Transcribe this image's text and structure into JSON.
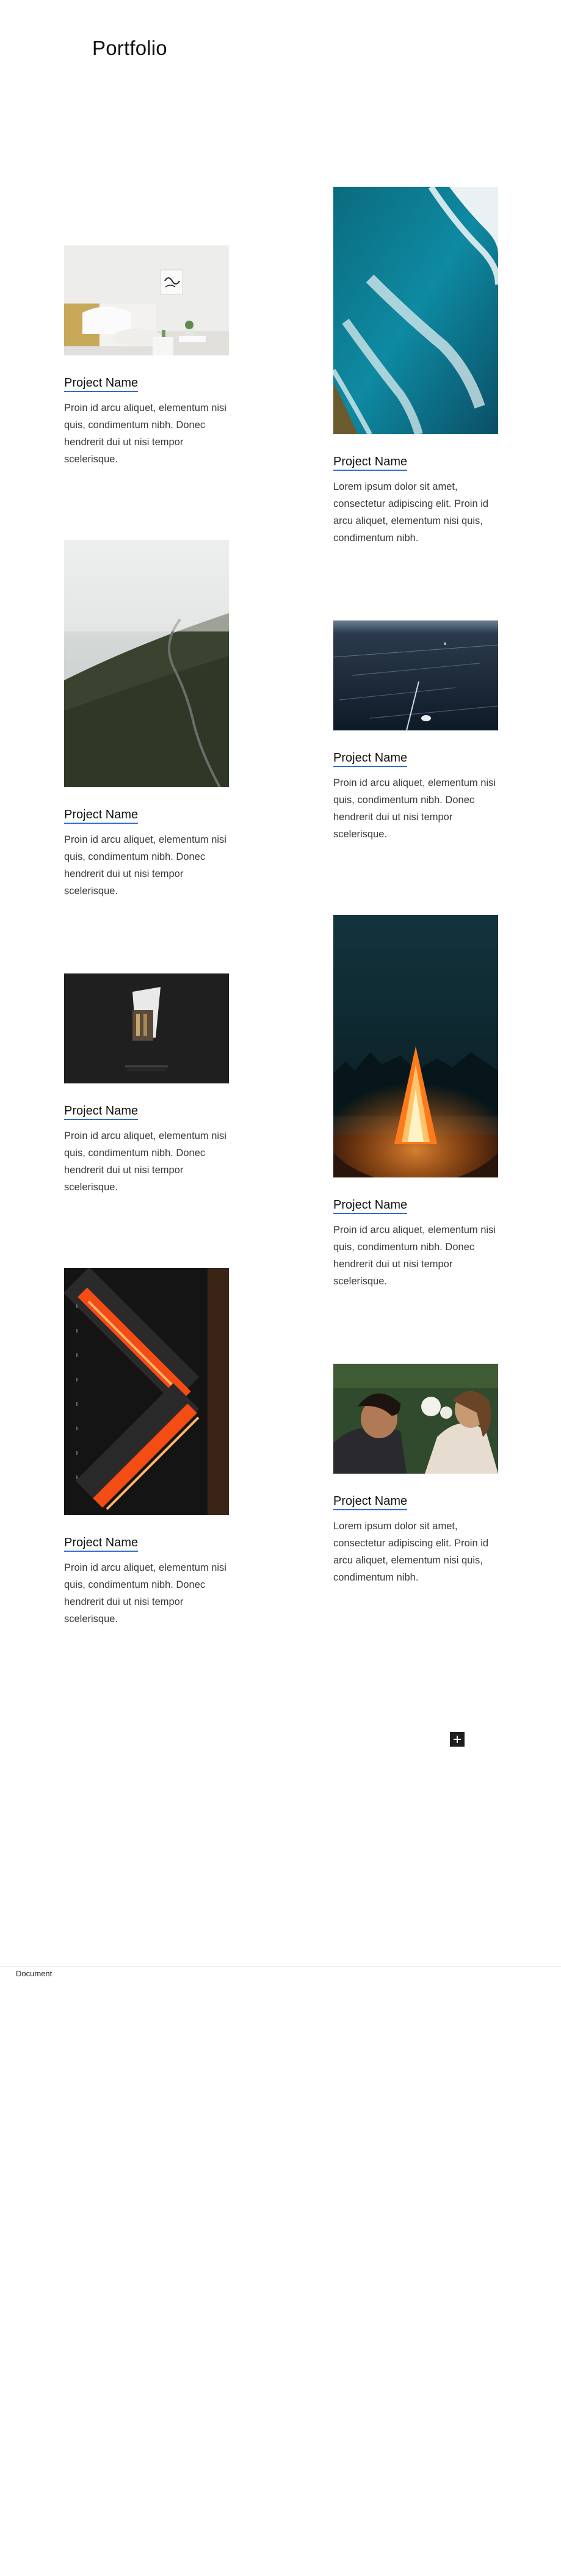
{
  "page": {
    "title": "Portfolio"
  },
  "projects": [
    {
      "name": "Project Name",
      "description": "Proin id arcu aliquet, elementum nisi quis, condimentum nibh. Donec hendrerit dui ut nisi tempor scelerisque.",
      "image": "bedroom-photo"
    },
    {
      "name": "Project Name",
      "description": "Lorem ipsum dolor sit amet, consectetur adipiscing elit. Proin id arcu aliquet, elementum nisi quis, condimentum nibh.",
      "image": "ocean-waves-aerial-photo"
    },
    {
      "name": "Project Name",
      "description": "Proin id arcu aliquet, elementum nisi quis, condimentum nibh. Donec hendrerit dui ut nisi tempor scelerisque.",
      "image": "foggy-mountain-road-photo"
    },
    {
      "name": "Project Name",
      "description": "Proin id arcu aliquet, elementum nisi quis, condimentum nibh. Donec hendrerit dui ut nisi tempor scelerisque.",
      "image": "ice-lake-photo"
    },
    {
      "name": "Project Name",
      "description": "Proin id arcu aliquet, elementum nisi quis, condimentum nibh. Donec hendrerit dui ut nisi tempor scelerisque.",
      "image": "building-night-photo"
    },
    {
      "name": "Project Name",
      "description": "Proin id arcu aliquet, elementum nisi quis, condimentum nibh. Donec hendrerit dui ut nisi tempor scelerisque.",
      "image": "bonfire-night-photo"
    },
    {
      "name": "Project Name",
      "description": "Proin id arcu aliquet, elementum nisi quis, condimentum nibh. Donec hendrerit dui ut nisi tempor scelerisque.",
      "image": "red-lit-staircase-photo"
    },
    {
      "name": "Project Name",
      "description": "Lorem ipsum dolor sit amet, consectetur adipiscing elit. Proin id arcu aliquet, elementum nisi quis, condimentum nibh.",
      "image": "couple-portrait-photo"
    }
  ],
  "add_block": {
    "icon": "plus-icon"
  },
  "footer": {
    "label": "Document"
  }
}
